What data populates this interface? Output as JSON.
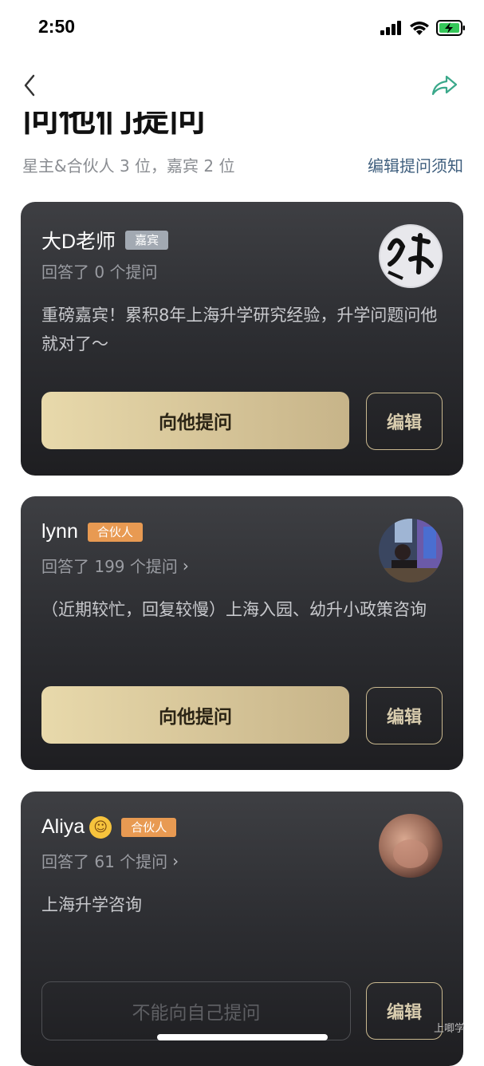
{
  "status_bar": {
    "time": "2:50"
  },
  "header": {
    "title": "问他们提问",
    "subtitle": "星主&合伙人 3 位，嘉宾 2 位",
    "edit_notice": "编辑提问须知"
  },
  "cards": [
    {
      "name": "大D老师",
      "badge": "嘉宾",
      "answered": "回答了 0 个提问",
      "description": "重磅嘉宾！累积8年上海升学研究经验，升学问题问他就对了～",
      "ask_label": "向他提问",
      "edit_label": "编辑"
    },
    {
      "name": "lynn",
      "badge": "合伙人",
      "answered": "回答了 199 个提问",
      "description": "（近期较忙，回复较慢）上海入园、幼升小政策咨询",
      "ask_label": "向他提问",
      "edit_label": "编辑"
    },
    {
      "name": "Aliya",
      "badge": "合伙人",
      "answered": "回答了 61 个提问",
      "description": "上海升学咨询",
      "ask_label": "不能向自己提问",
      "edit_label": "编辑"
    }
  ],
  "watermark": "上唧学",
  "colors": {
    "accent_gold": "#c7b489",
    "partner_badge": "#e89a52",
    "guest_badge": "#a2a9b2",
    "link_blue": "#3f5f7e",
    "share_green": "#3aa88a"
  },
  "icons": {
    "back": "chevron-left-icon",
    "share": "share-arrow-icon",
    "signal": "signal-icon",
    "wifi": "wifi-icon",
    "battery": "battery-charging-icon"
  }
}
